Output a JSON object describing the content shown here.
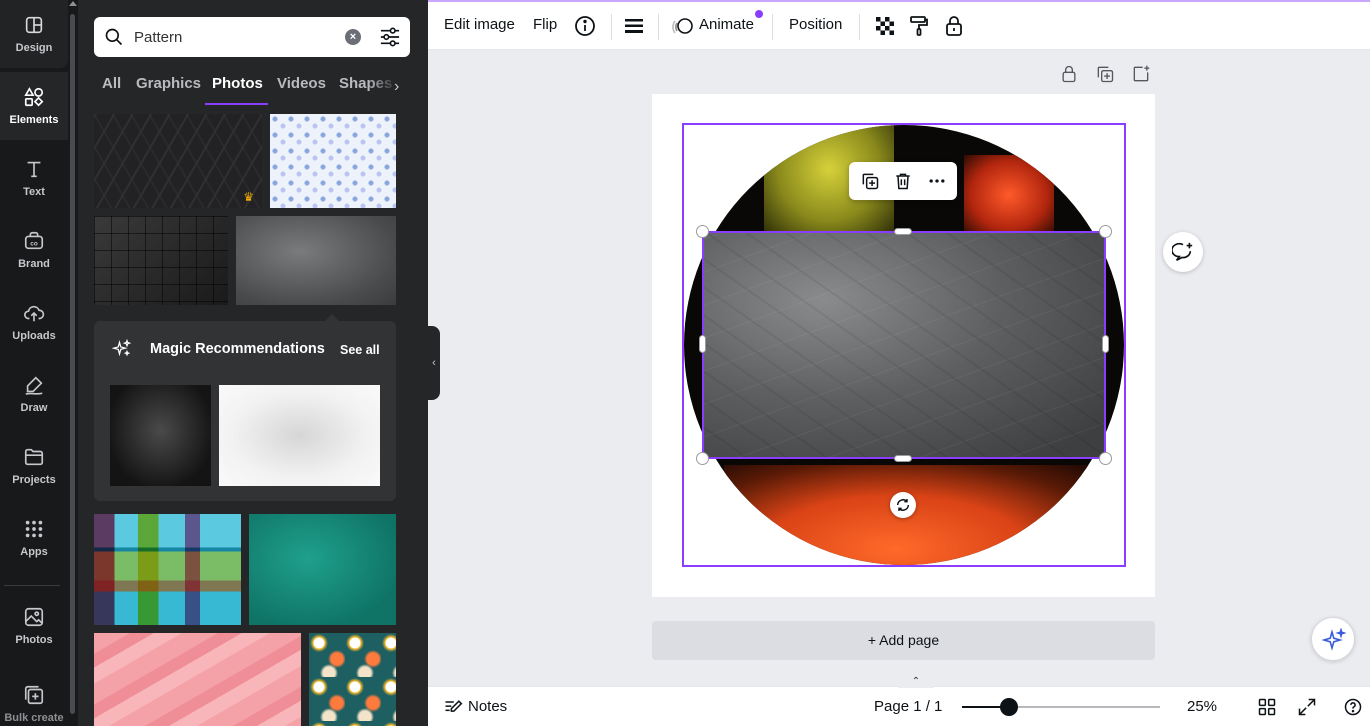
{
  "sidebar": {
    "items": [
      {
        "label": "Design",
        "icon": "design-icon"
      },
      {
        "label": "Elements",
        "icon": "elements-icon"
      },
      {
        "label": "Text",
        "icon": "text-icon"
      },
      {
        "label": "Brand",
        "icon": "brand-icon"
      },
      {
        "label": "Uploads",
        "icon": "uploads-icon"
      },
      {
        "label": "Draw",
        "icon": "draw-icon"
      },
      {
        "label": "Projects",
        "icon": "projects-icon"
      },
      {
        "label": "Apps",
        "icon": "apps-icon"
      },
      {
        "label": "Photos",
        "icon": "photos-icon"
      },
      {
        "label": "Bulk create",
        "icon": "bulk-create-icon"
      }
    ],
    "active": "Elements"
  },
  "panel": {
    "search": {
      "value": "Pattern"
    },
    "tabs": [
      "All",
      "Graphics",
      "Photos",
      "Videos",
      "Shapes"
    ],
    "active_tab": "Photos",
    "magic": {
      "title": "Magic Recommendations",
      "see_all": "See all"
    }
  },
  "toolbar": {
    "edit_image": "Edit image",
    "flip": "Flip",
    "animate": "Animate",
    "position": "Position"
  },
  "canvas": {
    "add_page": "+ Add page"
  },
  "bottom": {
    "notes": "Notes",
    "page_indicator": "Page 1 / 1",
    "zoom": "25%",
    "zoom_value": 25
  },
  "colors": {
    "accent": "#8b3dff",
    "sidebar_bg": "#18191b",
    "panel_bg": "#252627",
    "canvas_bg": "#ebecf0"
  }
}
